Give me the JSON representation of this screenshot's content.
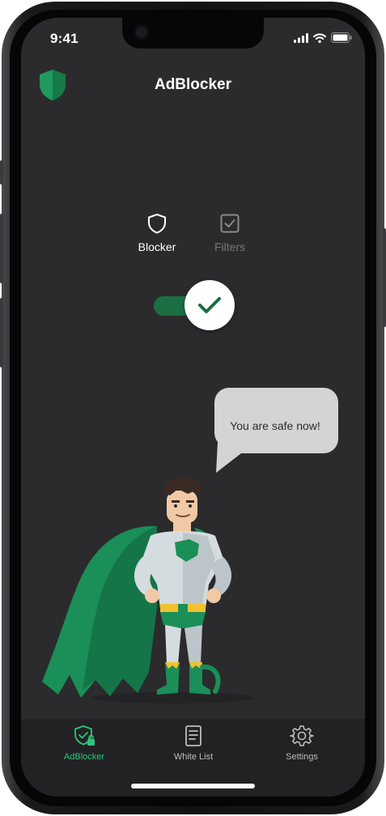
{
  "status_bar": {
    "time": "9:41",
    "icons": [
      "signal-icon",
      "wifi-icon",
      "battery-icon"
    ]
  },
  "header": {
    "title": "AdBlocker",
    "logo_icon": "shield-logo-icon"
  },
  "mode_tabs": [
    {
      "label": "Blocker",
      "icon": "shield-outline-icon",
      "active": true
    },
    {
      "label": "Filters",
      "icon": "checkbox-icon",
      "active": false
    }
  ],
  "blocker_toggle": {
    "state": "on",
    "icon": "checkmark-icon"
  },
  "speech_bubble": {
    "text": "You are safe now!"
  },
  "tab_bar": {
    "items": [
      {
        "label": "AdBlocker",
        "icon": "shield-lock-icon",
        "active": true
      },
      {
        "label": "White List",
        "icon": "document-list-icon",
        "active": false
      },
      {
        "label": "Settings",
        "icon": "gear-icon",
        "active": false
      }
    ]
  },
  "colors": {
    "background": "#2b2b2d",
    "accent": "#2bc77a",
    "toggle_track": "#1c6f43",
    "tab_bar": "#222224",
    "inactive_text": "#78787a"
  }
}
